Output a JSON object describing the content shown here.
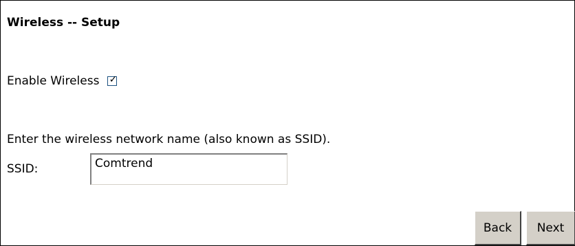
{
  "page": {
    "title": "Wireless -- Setup"
  },
  "enable_wireless": {
    "label": "Enable Wireless",
    "checked": true
  },
  "ssid_section": {
    "instruction": "Enter the wireless network name (also known as SSID).",
    "label": "SSID:",
    "value": "Comtrend"
  },
  "buttons": {
    "back_label": "Back",
    "next_label": "Next"
  },
  "colors": {
    "button_face": "#d4d0c8",
    "checkbox_border": "#1c5180"
  }
}
